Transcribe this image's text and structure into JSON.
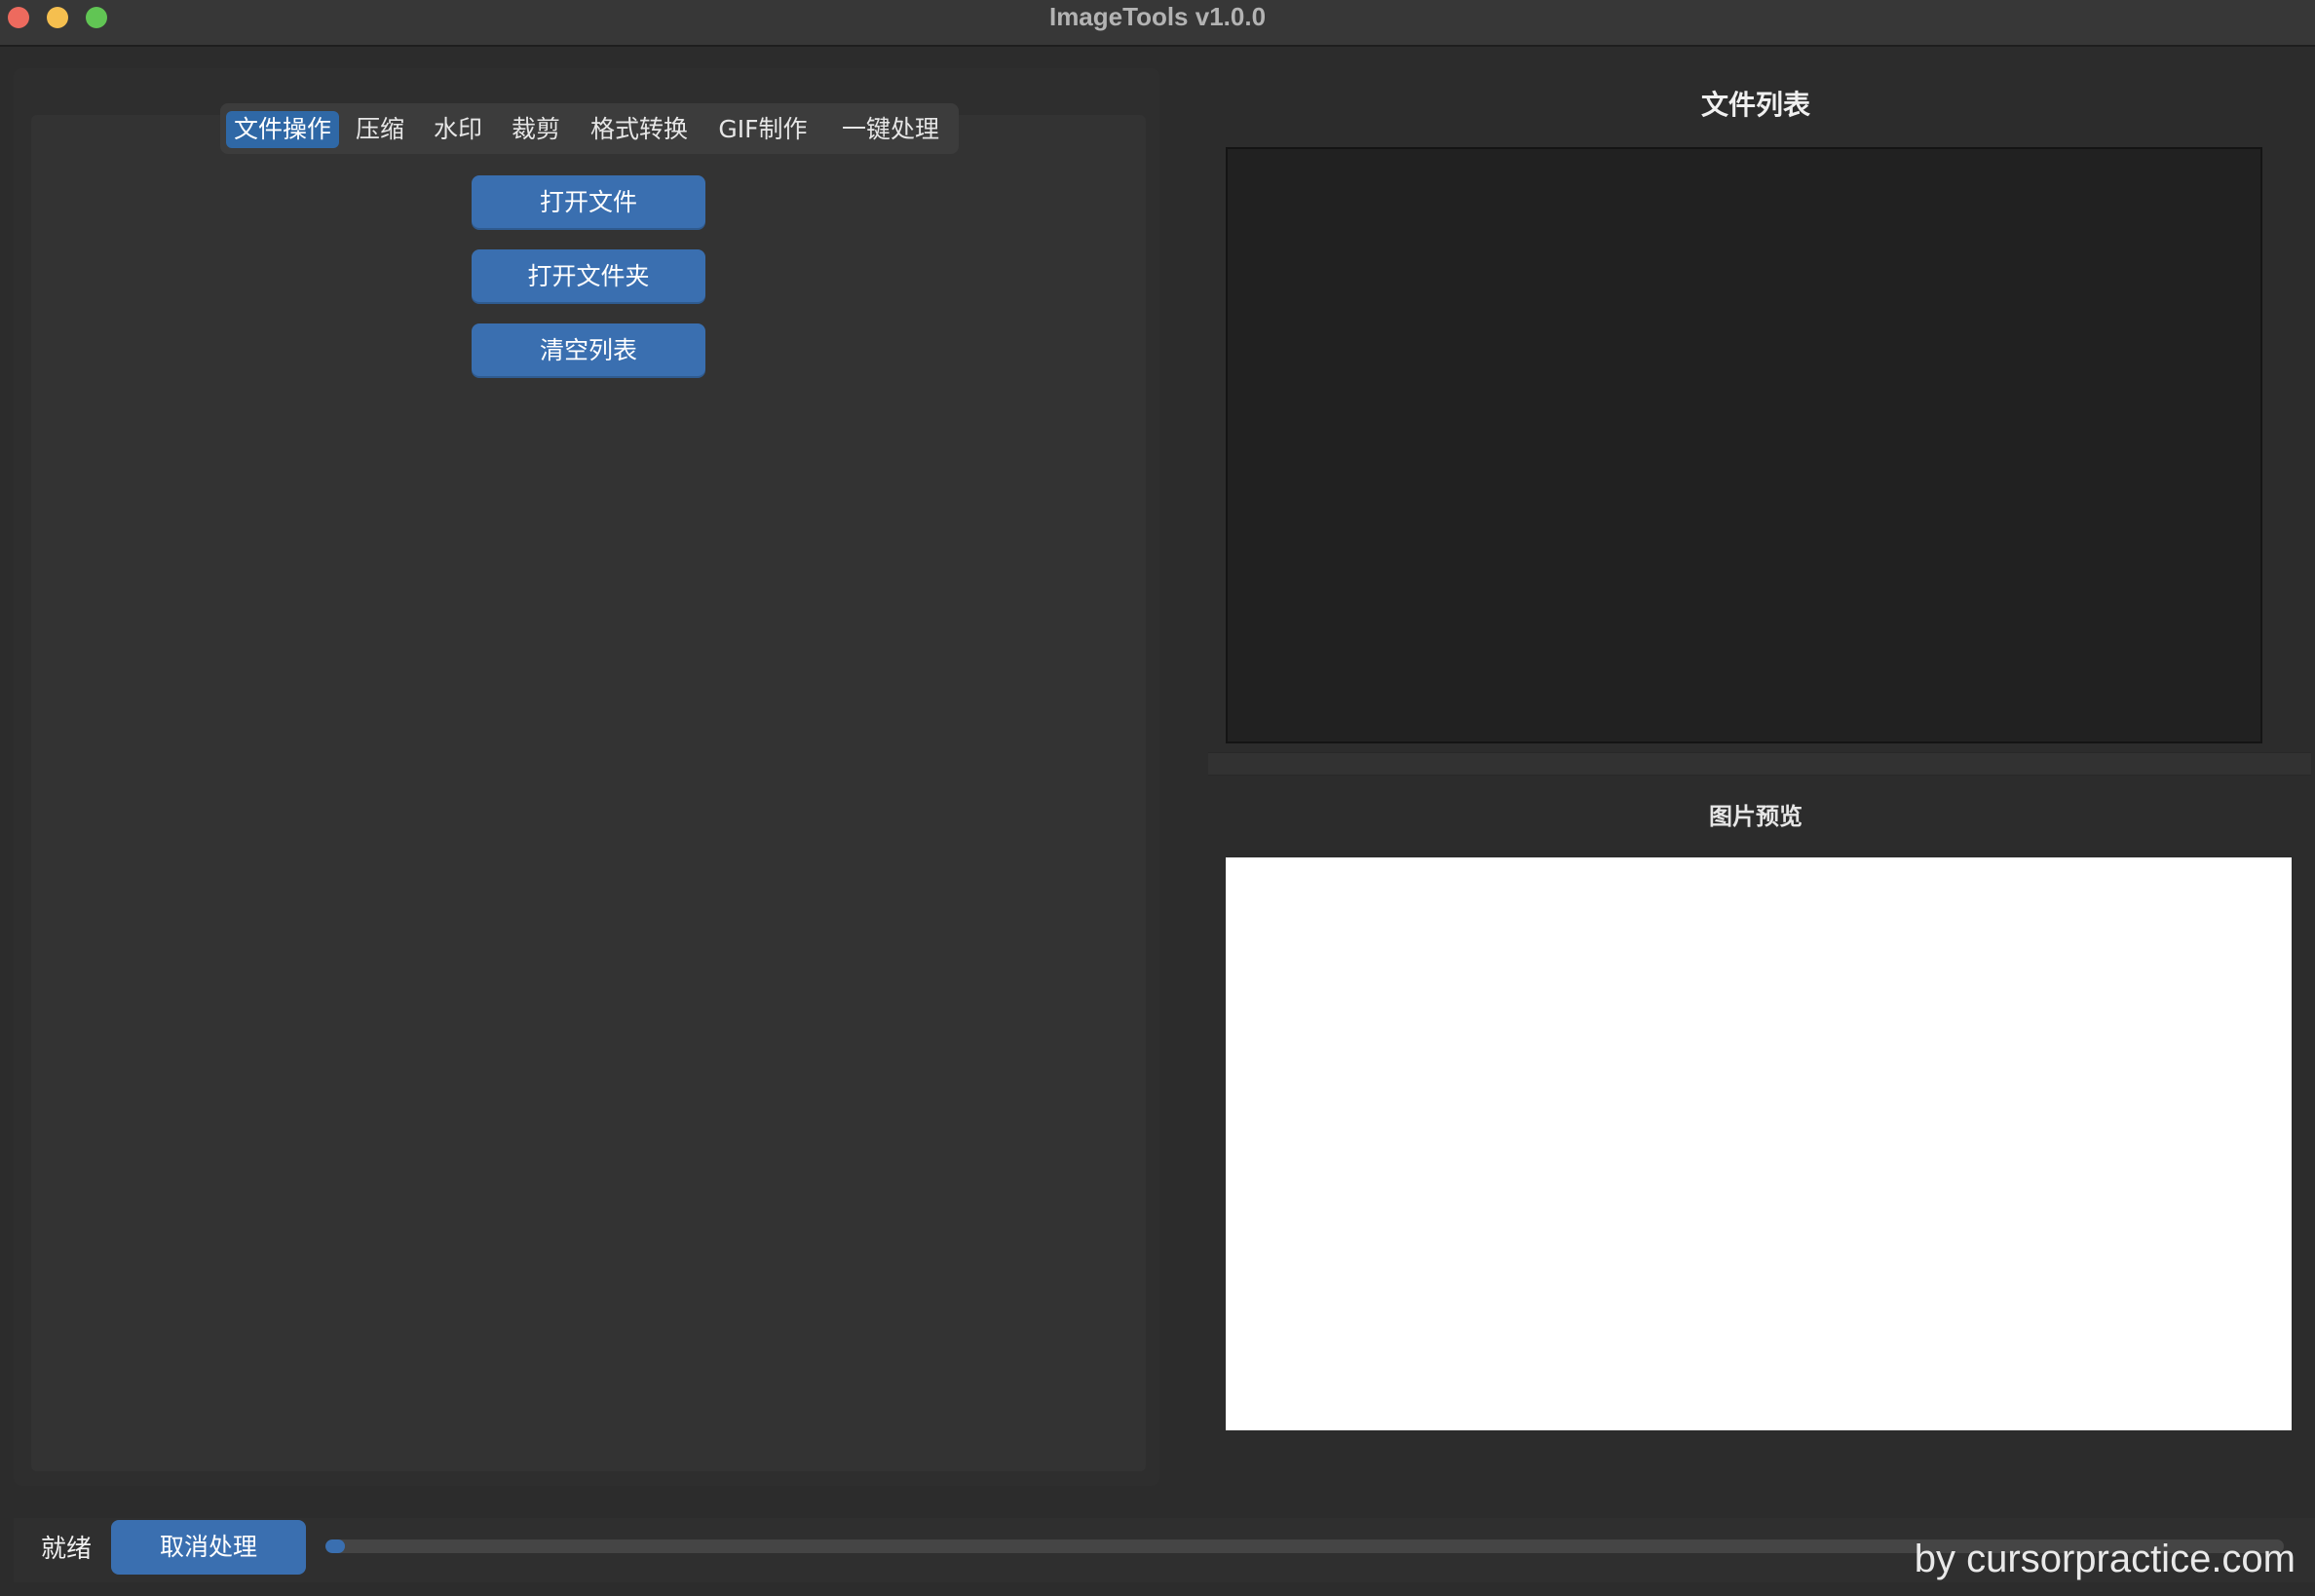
{
  "window": {
    "title": "ImageTools v1.0.0"
  },
  "tabs": [
    {
      "label": "文件操作",
      "active": true
    },
    {
      "label": "压缩",
      "active": false
    },
    {
      "label": "水印",
      "active": false
    },
    {
      "label": "裁剪",
      "active": false
    },
    {
      "label": "格式转换",
      "active": false
    },
    {
      "label": "GIF制作",
      "active": false
    },
    {
      "label": "一键处理",
      "active": false
    }
  ],
  "file_ops": {
    "open_file": "打开文件",
    "open_folder": "打开文件夹",
    "clear_list": "清空列表"
  },
  "file_list": {
    "title": "文件列表"
  },
  "preview": {
    "title": "图片预览"
  },
  "status": {
    "text": "就绪",
    "cancel_label": "取消处理",
    "progress": 0.01
  },
  "watermark": "by cursorpractice.com",
  "colors": {
    "accent": "#3a6fb0",
    "background": "#2c2c2c"
  }
}
